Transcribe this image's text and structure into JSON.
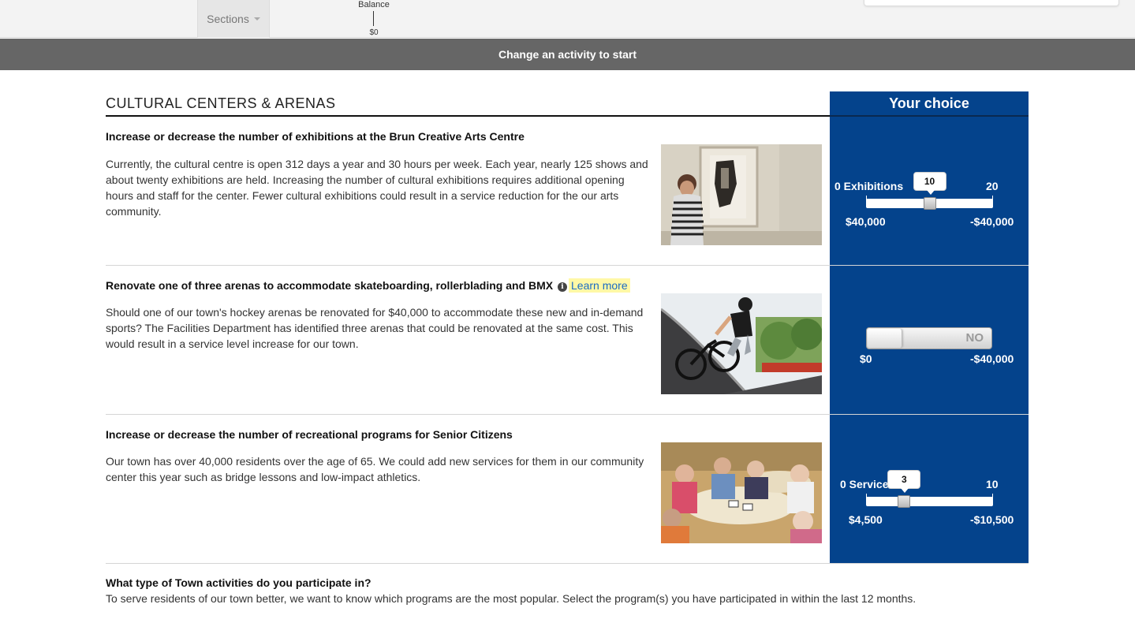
{
  "topbar": {
    "sections_label": "Sections",
    "balance_label": "Balance",
    "balance_value": "$0"
  },
  "banner": {
    "text": "Change an activity to start"
  },
  "section": {
    "title": "CULTURAL CENTERS & ARENAS",
    "choice_header": "Your choice"
  },
  "rows": [
    {
      "title": "Increase or decrease the number of exhibitions at the Brun Creative Arts Centre",
      "description": "Currently, the cultural centre is open 312 days a year and 30 hours per week. Each year, nearly 125 shows and about twenty exhibitions are held. Increasing the number of cultural exhibitions requires additional opening hours and staff for the center. Fewer cultural exhibitions could result in a service reduction for the our arts community.",
      "image": "woman viewing artwork in gallery",
      "control": {
        "type": "slider",
        "min_label": "0 Exhibitions",
        "max_label": "20",
        "min": 0,
        "max": 20,
        "value": 10,
        "value_label": "10",
        "low_cost": "$40,000",
        "high_cost": "-$40,000"
      }
    },
    {
      "title": "Renovate one of three arenas to accommodate skateboarding, rollerblading and BMX",
      "learn_more": "Learn more",
      "description": "Should one of our town's hockey arenas be renovated for $40,000 to accommodate these new and in-demand sports? The Facilities Department has identified three arenas that could be renovated at the same cost. This would result in a service level increase for our town.",
      "image": "BMX rider on ramp",
      "control": {
        "type": "toggle",
        "state_label": "NO",
        "low_cost": "$0",
        "high_cost": "-$40,000"
      }
    },
    {
      "title": "Increase or decrease the number of recreational programs for Senior Citizens",
      "description": "Our town has over 40,000 residents over the age of 65. We could add new services for them in our community center this year such as bridge lessons and low-impact athletics.",
      "image": "seniors playing cards at tables",
      "control": {
        "type": "slider",
        "min_label": "0 Services",
        "max_label": "10",
        "min": 0,
        "max": 10,
        "value": 3,
        "value_label": "3",
        "low_cost": "$4,500",
        "high_cost": "-$10,500"
      }
    }
  ],
  "question": {
    "title": "What type of Town activities do you participate in?",
    "description": "To serve residents of our town better, we want to know which programs are the most popular. Select the program(s) you have participated in within the last 12 months."
  },
  "colors": {
    "panel_blue": "#04438c",
    "banner_gray": "#666666",
    "learn_more_highlight": "#fff8a6",
    "link_blue": "#1a6bc4"
  }
}
